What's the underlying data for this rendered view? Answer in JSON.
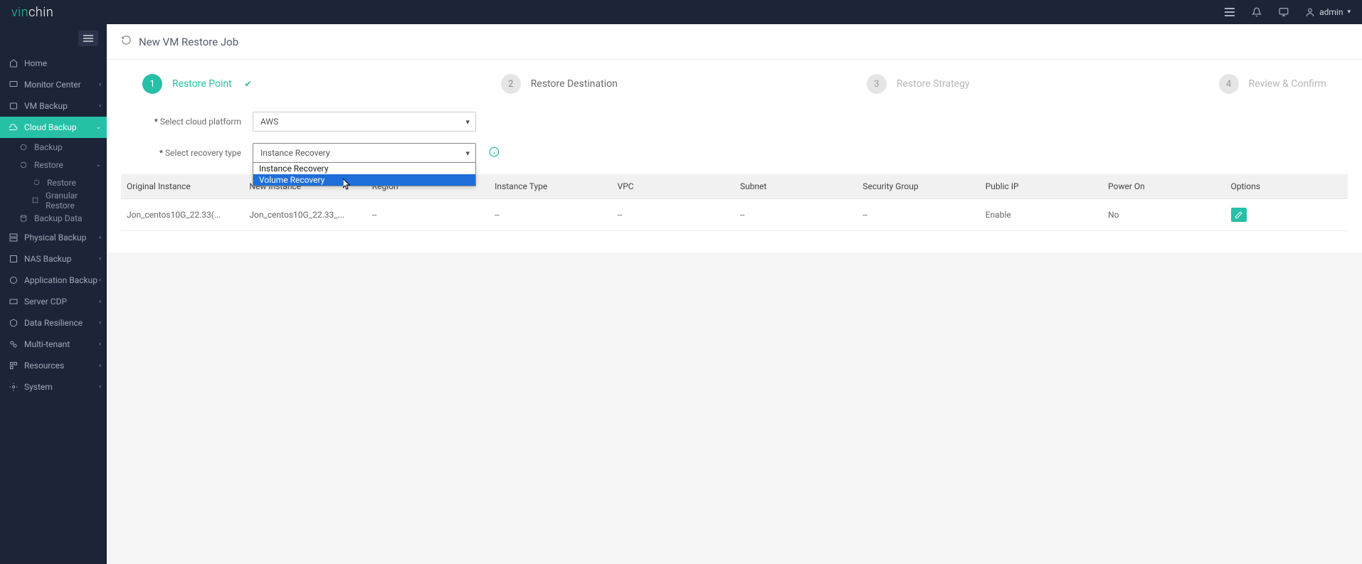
{
  "brand": {
    "part1": "vin",
    "part2": "chin"
  },
  "topbar": {
    "user": "admin"
  },
  "page": {
    "title": "New VM Restore Job"
  },
  "sidebar": {
    "items": [
      {
        "label": "Home"
      },
      {
        "label": "Monitor Center"
      },
      {
        "label": "VM Backup"
      },
      {
        "label": "Cloud Backup"
      },
      {
        "label": "Backup"
      },
      {
        "label": "Restore"
      },
      {
        "label": "Restore"
      },
      {
        "label": "Granular Restore"
      },
      {
        "label": "Backup Data"
      },
      {
        "label": "Physical Backup"
      },
      {
        "label": "NAS Backup"
      },
      {
        "label": "Application Backup"
      },
      {
        "label": "Server CDP"
      },
      {
        "label": "Data Resilience"
      },
      {
        "label": "Multi-tenant"
      },
      {
        "label": "Resources"
      },
      {
        "label": "System"
      }
    ]
  },
  "wizard": {
    "steps": [
      {
        "num": "1",
        "label": "Restore Point"
      },
      {
        "num": "2",
        "label": "Restore Destination"
      },
      {
        "num": "3",
        "label": "Restore Strategy"
      },
      {
        "num": "4",
        "label": "Review & Confirm"
      }
    ]
  },
  "form": {
    "platform_label": "Select cloud platform",
    "platform_value": "AWS",
    "recovery_label": "Select recovery type",
    "recovery_value": "Instance Recovery",
    "recovery_options": [
      "Instance Recovery",
      "Volume Recovery"
    ]
  },
  "table": {
    "headers": {
      "original": "Original Instance",
      "new": "New Instance",
      "region": "Region",
      "type": "Instance Type",
      "vpc": "VPC",
      "subnet": "Subnet",
      "sg": "Security Group",
      "publicip": "Public IP",
      "poweron": "Power On",
      "options": "Options"
    },
    "rows": [
      {
        "original": "Jon_centos10G_22.33(...",
        "new": "Jon_centos10G_22.33_...",
        "region": "--",
        "type": "--",
        "vpc": "--",
        "subnet": "--",
        "sg": "--",
        "publicip": "Enable",
        "poweron": "No"
      }
    ]
  }
}
